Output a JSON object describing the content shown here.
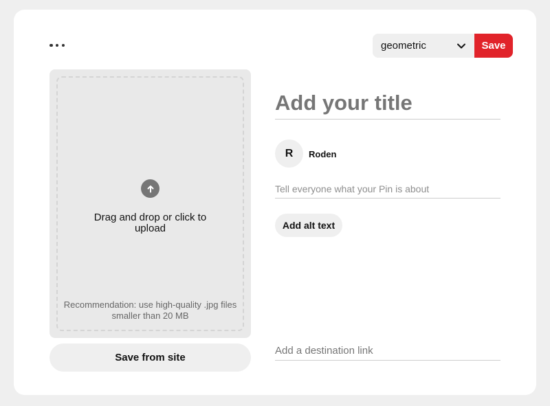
{
  "header": {
    "more_icon": "more-horizontal-icon",
    "board_select": {
      "selected": "geometric",
      "icon": "chevron-down-icon"
    },
    "save_label": "Save",
    "accent_color": "#e1232a"
  },
  "upload": {
    "icon": "upload-arrow-icon",
    "text": "Drag and drop or click to upload",
    "recommendation": "Recommendation: use high-quality .jpg files smaller than 20 MB"
  },
  "save_from_site_label": "Save from site",
  "form": {
    "title_placeholder": "Add your title",
    "user": {
      "initial": "R",
      "name": "Roden"
    },
    "description_placeholder": "Tell everyone what your Pin is about",
    "alt_text_label": "Add alt text",
    "link_placeholder": "Add a destination link"
  }
}
